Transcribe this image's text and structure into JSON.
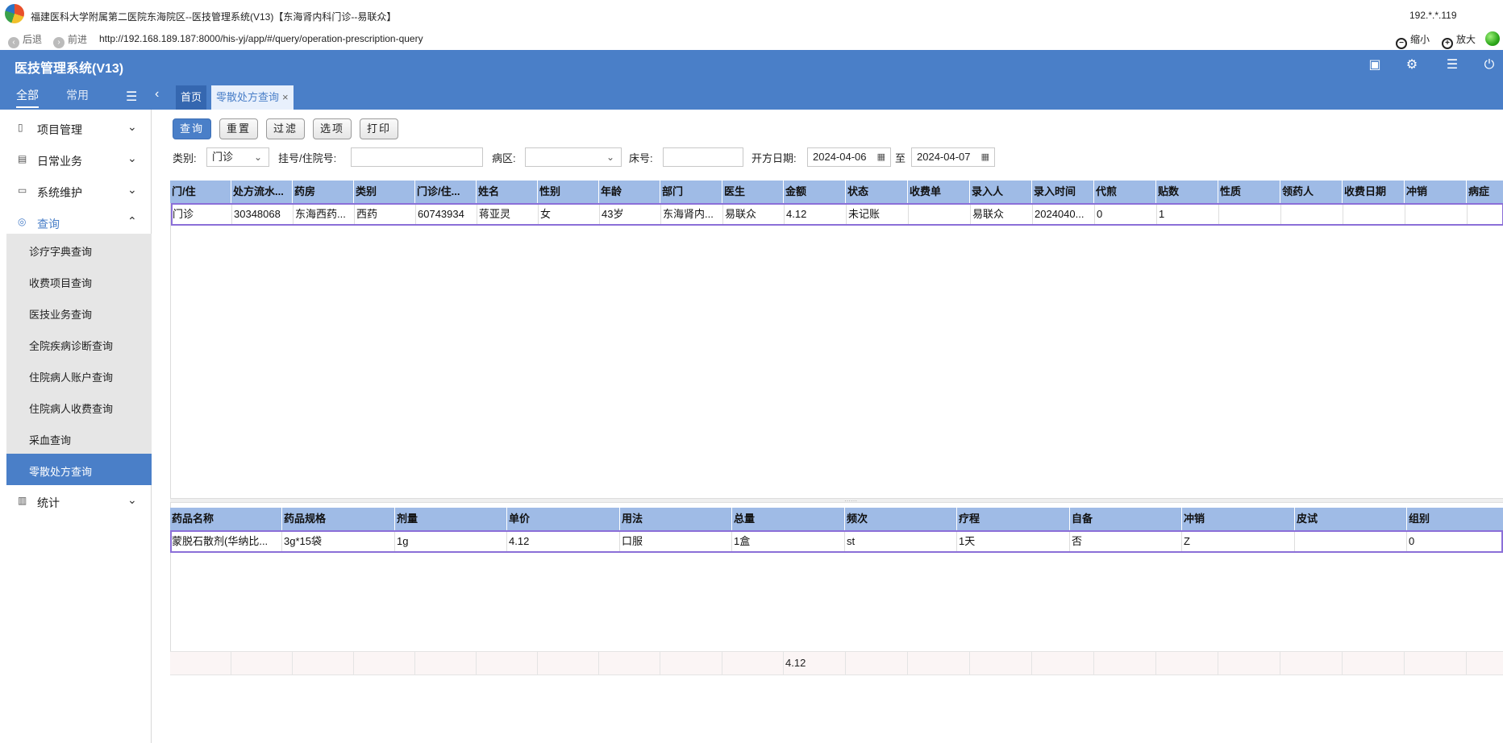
{
  "window": {
    "title": "福建医科大学附属第二医院东海院区--医技管理系统(V13)【东海肾内科门诊--易联众】",
    "ip": "192.*.*.119"
  },
  "addressbar": {
    "back": "后退",
    "forward": "前进",
    "url": "http://192.168.189.187:8000/his-yj/app/#/query/operation-prescription-query",
    "zoom_out": "缩小",
    "zoom_in": "放大"
  },
  "app": {
    "title": "医技管理系统(V13)"
  },
  "sidebar": {
    "tabs": [
      "全部",
      "常用"
    ],
    "menu": [
      {
        "label": "项目管理",
        "icon": "document-icon"
      },
      {
        "label": "日常业务",
        "icon": "calendar-icon"
      },
      {
        "label": "系统维护",
        "icon": "monitor-icon"
      },
      {
        "label": "查询",
        "icon": "search-icon"
      },
      {
        "label": "统计",
        "icon": "chart-icon"
      }
    ],
    "submenu": [
      "诊疗字典查询",
      "收费项目查询",
      "医技业务查询",
      "全院疾病诊断查询",
      "住院病人账户查询",
      "住院病人收费查询",
      "采血查询",
      "零散处方查询"
    ]
  },
  "tabs": {
    "home": "首页",
    "current": "零散处方查询",
    "close": "×"
  },
  "toolbar": {
    "query": "查询",
    "reset": "重置",
    "filter": "过滤",
    "options": "选项",
    "print": "打印"
  },
  "filters": {
    "category_label": "类别:",
    "category_value": "门诊",
    "reg_label": "挂号/住院号:",
    "reg_value": "",
    "ward_label": "病区:",
    "ward_value": "",
    "bed_label": "床号:",
    "bed_value": "",
    "date_label": "开方日期:",
    "date_from": "2024-04-06",
    "date_to_label": "至",
    "date_to": "2024-04-07"
  },
  "grid1": {
    "columns": [
      "门/住",
      "处方流水...",
      "药房",
      "类别",
      "门诊/住...",
      "姓名",
      "性别",
      "年龄",
      "部门",
      "医生",
      "金额",
      "状态",
      "收费单",
      "录入人",
      "录入时间",
      "代煎",
      "贴数",
      "性质",
      "领药人",
      "收费日期",
      "冲销",
      "病症"
    ],
    "rows": [
      [
        "门诊",
        "30348068",
        "东海西药...",
        "西药",
        "60743934",
        "蒋亚灵",
        "女",
        "43岁",
        "东海肾内...",
        "易联众",
        "4.12",
        "未记账",
        "",
        "易联众",
        "2024040...",
        "0",
        "1",
        "",
        "",
        "",
        "",
        ""
      ]
    ],
    "footer_total": "4.12"
  },
  "grid2": {
    "columns": [
      "药品名称",
      "药品规格",
      "剂量",
      "单价",
      "用法",
      "总量",
      "频次",
      "疗程",
      "自备",
      "冲销",
      "皮试",
      "组别"
    ],
    "rows": [
      [
        "蒙脱石散剂(华纳比...",
        "3g*15袋",
        "1g",
        "4.12",
        "口服",
        "1盒",
        "st",
        "1天",
        "否",
        "Z",
        "",
        "0"
      ]
    ]
  },
  "colors": {
    "primary": "#4a7fc8",
    "grid_header": "#9fbbe6",
    "row_select": "#8b6fd8"
  }
}
